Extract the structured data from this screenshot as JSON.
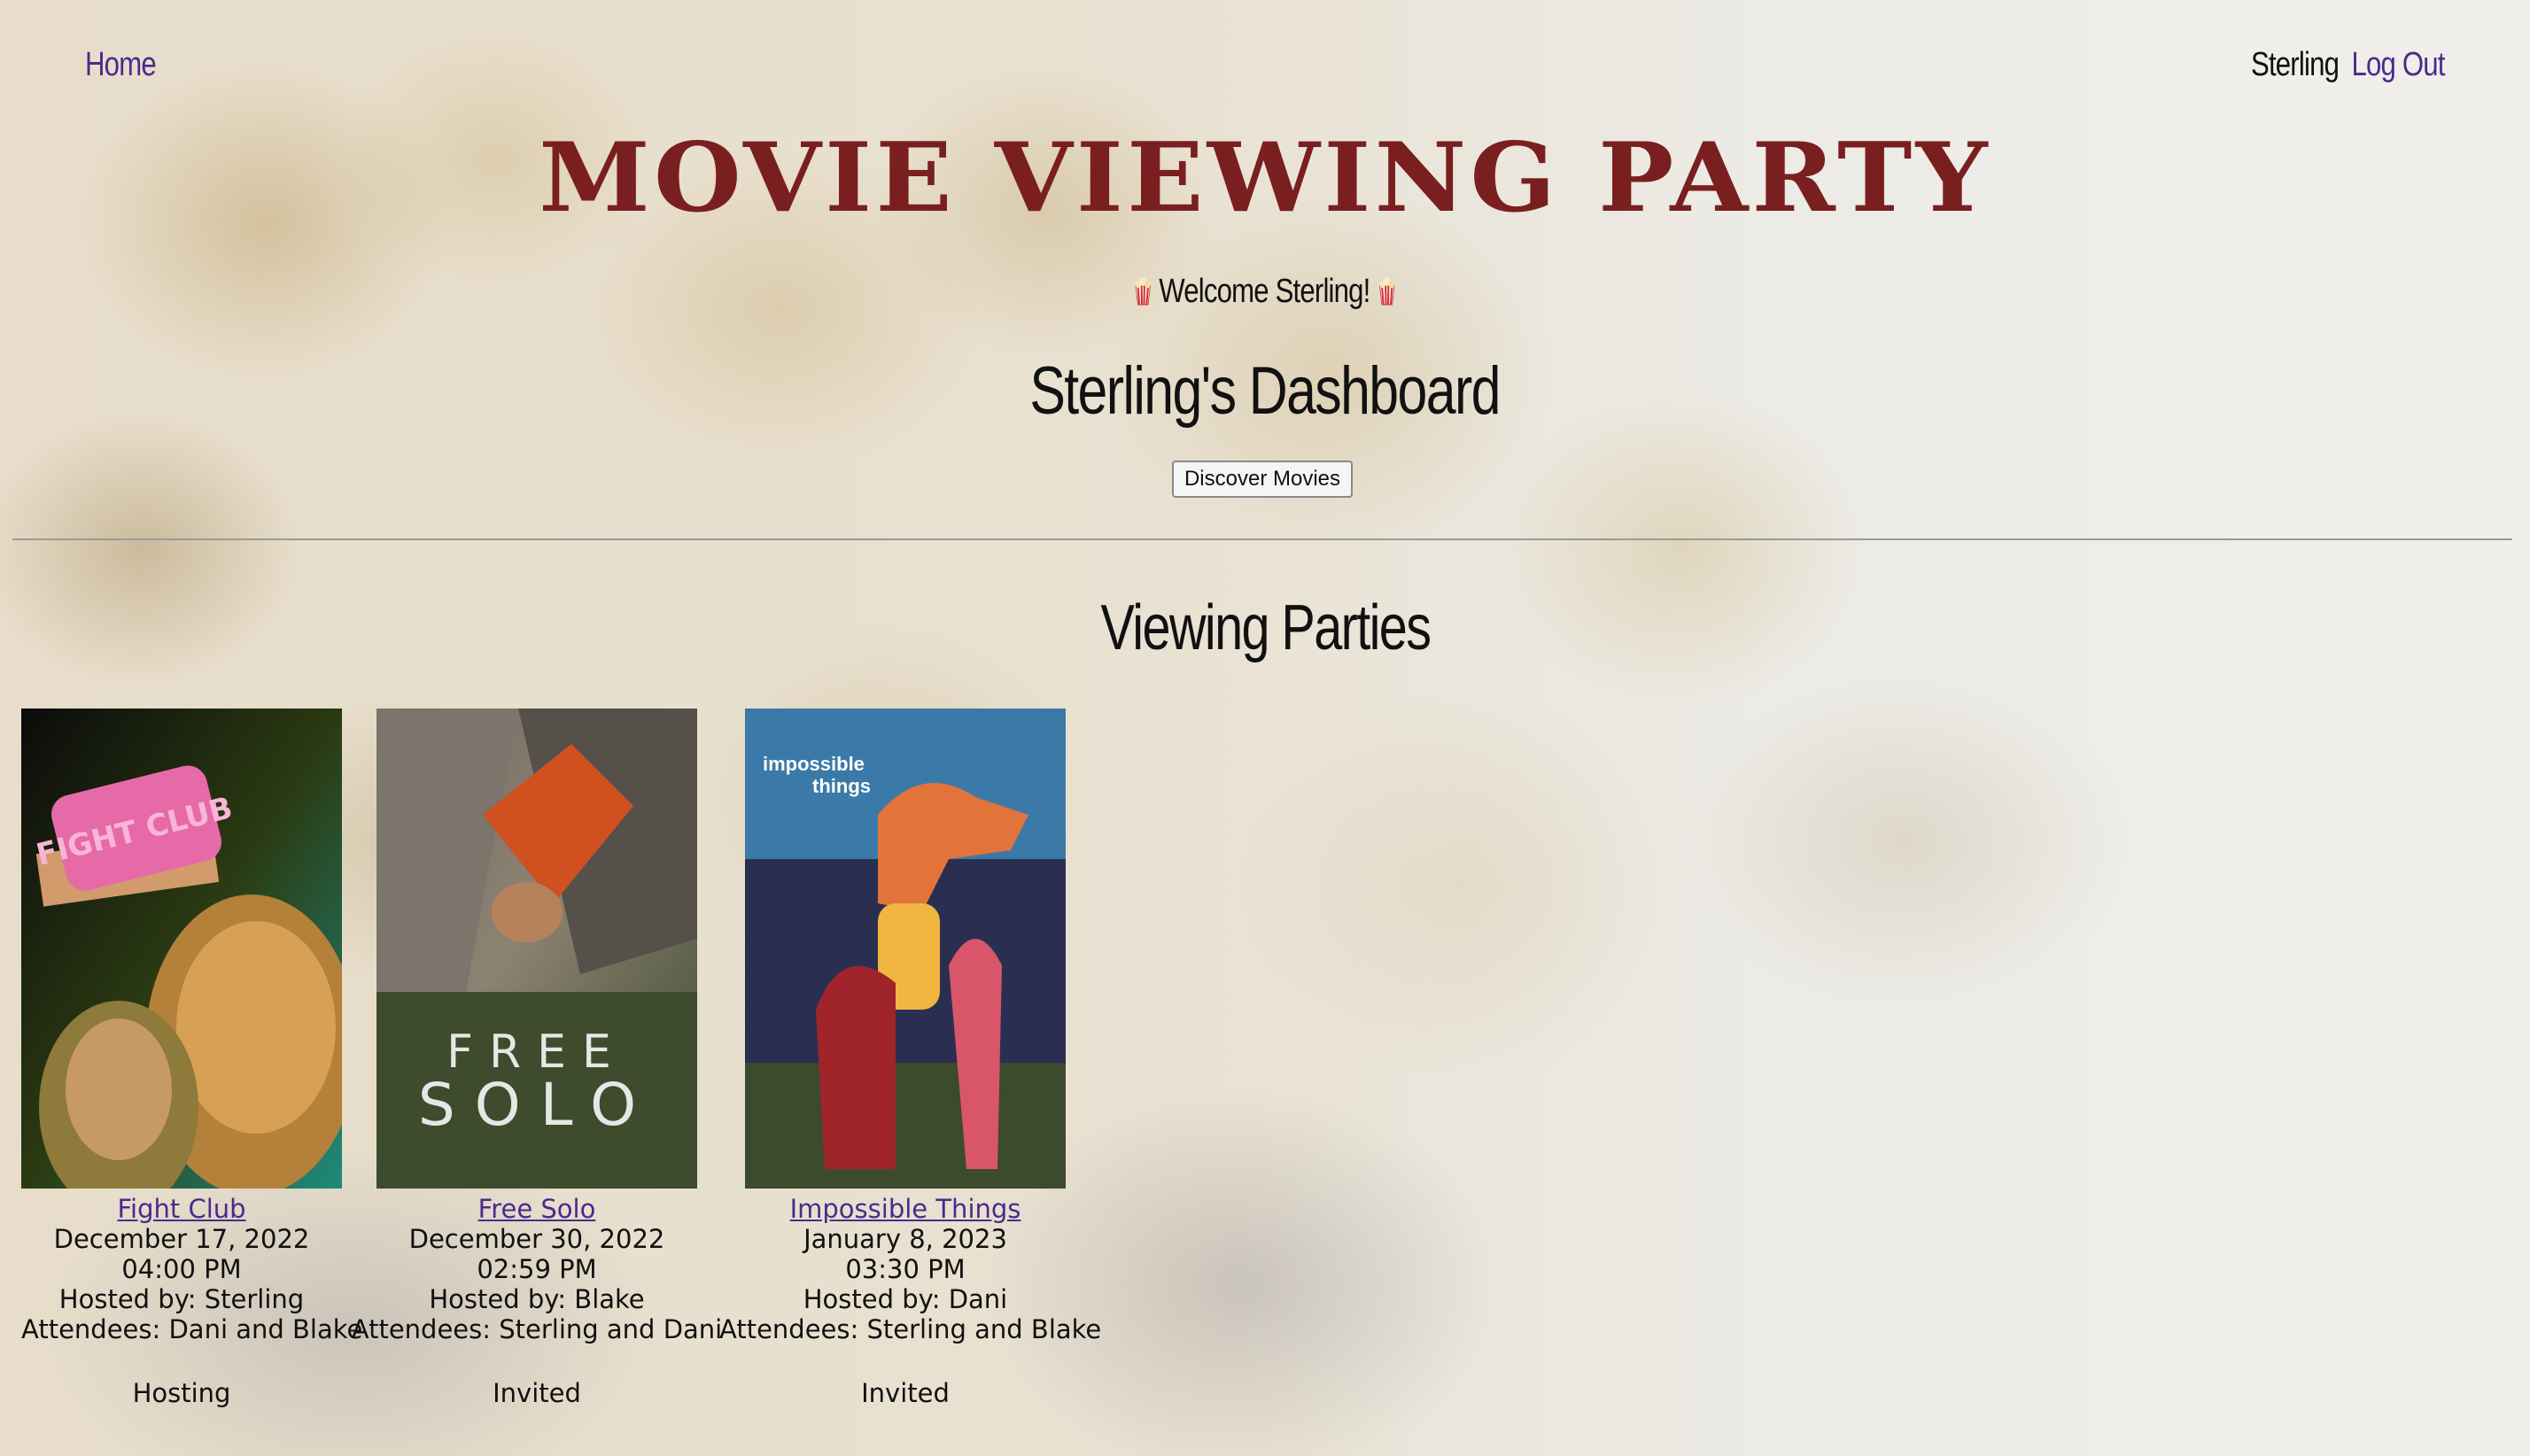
{
  "nav": {
    "home_label": "Home",
    "user_name": "Sterling",
    "logout_label": "Log Out"
  },
  "site_title": "MOVIE VIEWING PARTY",
  "welcome": {
    "icon": "popcorn-icon",
    "text": "Welcome Sterling!"
  },
  "dashboard_title": "Sterling's Dashboard",
  "discover_button": "Discover Movies",
  "parties_title": "Viewing Parties",
  "colors": {
    "title": "#7a1f1f",
    "link": "#4b2a8c"
  },
  "parties": [
    {
      "title": "Fight Club",
      "date": "December 17, 2022",
      "time": "04:00 PM",
      "hosted_by": "Hosted by: Sterling",
      "attendees": "Attendees: Dani and Blake",
      "status": "Hosting",
      "poster_text": "FIGHT CLUB"
    },
    {
      "title": "Free Solo",
      "date": "December 30, 2022",
      "time": "02:59 PM",
      "hosted_by": "Hosted by: Blake",
      "attendees": "Attendees: Sterling and Dani",
      "status": "Invited",
      "poster_text_top": "FREE",
      "poster_text_bottom": "SOLO"
    },
    {
      "title": "Impossible Things",
      "date": "January 8, 2023",
      "time": "03:30 PM",
      "hosted_by": "Hosted by: Dani",
      "attendees": "Attendees: Sterling and Blake",
      "status": "Invited",
      "poster_text_top": "impossible",
      "poster_text_bottom": "things"
    }
  ]
}
